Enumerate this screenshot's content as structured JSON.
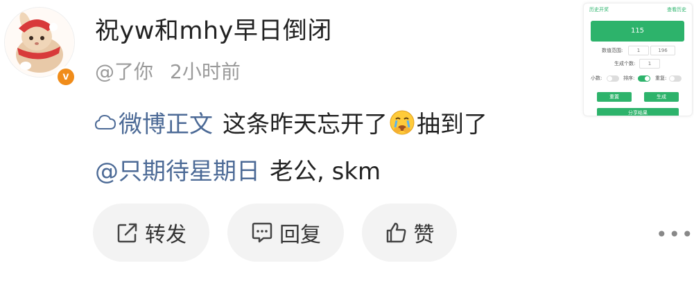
{
  "post": {
    "title": "祝yw和mhy早日倒闭",
    "author": "@了你",
    "time": "2小时前",
    "topic": "微博正文",
    "text_before_emoji": "这条昨天忘开了",
    "text_after_emoji": "抽到了",
    "mention": "@只期待星期日",
    "text_after_mention": "老公, skm"
  },
  "actions": {
    "forward_label": "转发",
    "reply_label": "回复",
    "like_label": "赞",
    "more_label": "•••"
  },
  "widget": {
    "history_label": "历史开奖",
    "history_link": "查看历史",
    "result": "115",
    "range_label": "数值范围:",
    "range_min": "1",
    "range_max": "196",
    "count_label": "生成个数:",
    "count_value": "1",
    "decimal_label": "小数:",
    "sort_label": "排序:",
    "repeat_label": "重复:",
    "reset_label": "重置",
    "generate_label": "生成",
    "share_label": "分享结果"
  },
  "colors": {
    "link": "#4c6a96",
    "verified_badge": "#f08c1a",
    "widget_green": "#2db36b"
  },
  "icons": [
    "weibo-topic-icon",
    "forward-icon",
    "comment-icon",
    "thumbs-up-icon",
    "more-icon"
  ]
}
